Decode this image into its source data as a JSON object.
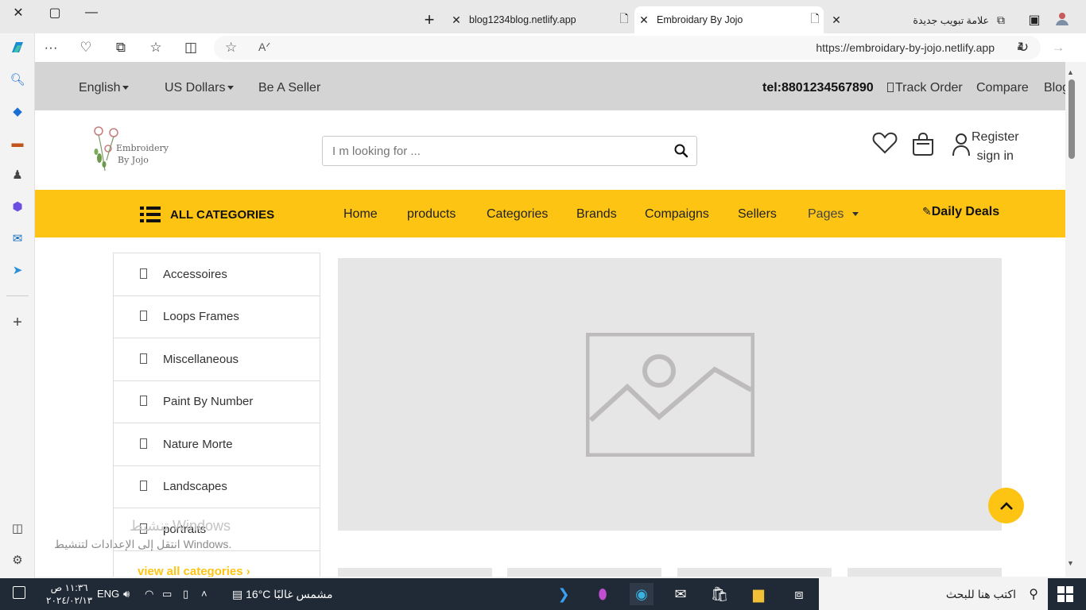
{
  "browser": {
    "window_controls": {
      "close": "✕",
      "restore": "▢",
      "minimize": "—"
    },
    "new_tab": "+",
    "tabs": [
      {
        "title": "blog1234blog.netlify.app"
      },
      {
        "title": "Embroidary By Jojo"
      },
      {
        "title": "علامة تبويب جديدة"
      }
    ],
    "url": "https://embroidary-by-jojo.netlify.app"
  },
  "site": {
    "topbar": {
      "language": "English",
      "currency": "US Dollars",
      "seller": "Be A Seller",
      "phone": "tel:8801234567890",
      "track": "Track Order",
      "compare": "Compare",
      "blog": "Blog"
    },
    "logo": {
      "line1": "Embroidery",
      "line2": "By Jojo"
    },
    "search": {
      "placeholder": "I m looking for ..."
    },
    "account": {
      "register": "Register",
      "signin": "sign in"
    },
    "nav": {
      "all_categories": "ALL CATEGORIES",
      "items": [
        "Home",
        "products",
        "Categories",
        "Brands",
        "Compaigns",
        "Sellers"
      ],
      "pages": "Pages",
      "daily_deals": "Daily Deals"
    },
    "categories": [
      "Accessoires",
      "Loops Frames",
      "Miscellaneous",
      "Paint By Number",
      "Nature Morte",
      "Landscapes",
      "portraits"
    ],
    "view_all": "view all categories ›",
    "accent": "#fdc414"
  },
  "watermark": {
    "line1": "تنشيط Windows",
    "line2": "انتقل إلى الإعدادات لتنشيط Windows."
  },
  "taskbar": {
    "search_placeholder": "اكتب هنا للبحث",
    "weather": "16°C  مشمس غالبًا",
    "lang": "ENG",
    "time": "١١:٣٦ ص",
    "date": "٢٠٢٤/٠٢/١٣"
  }
}
